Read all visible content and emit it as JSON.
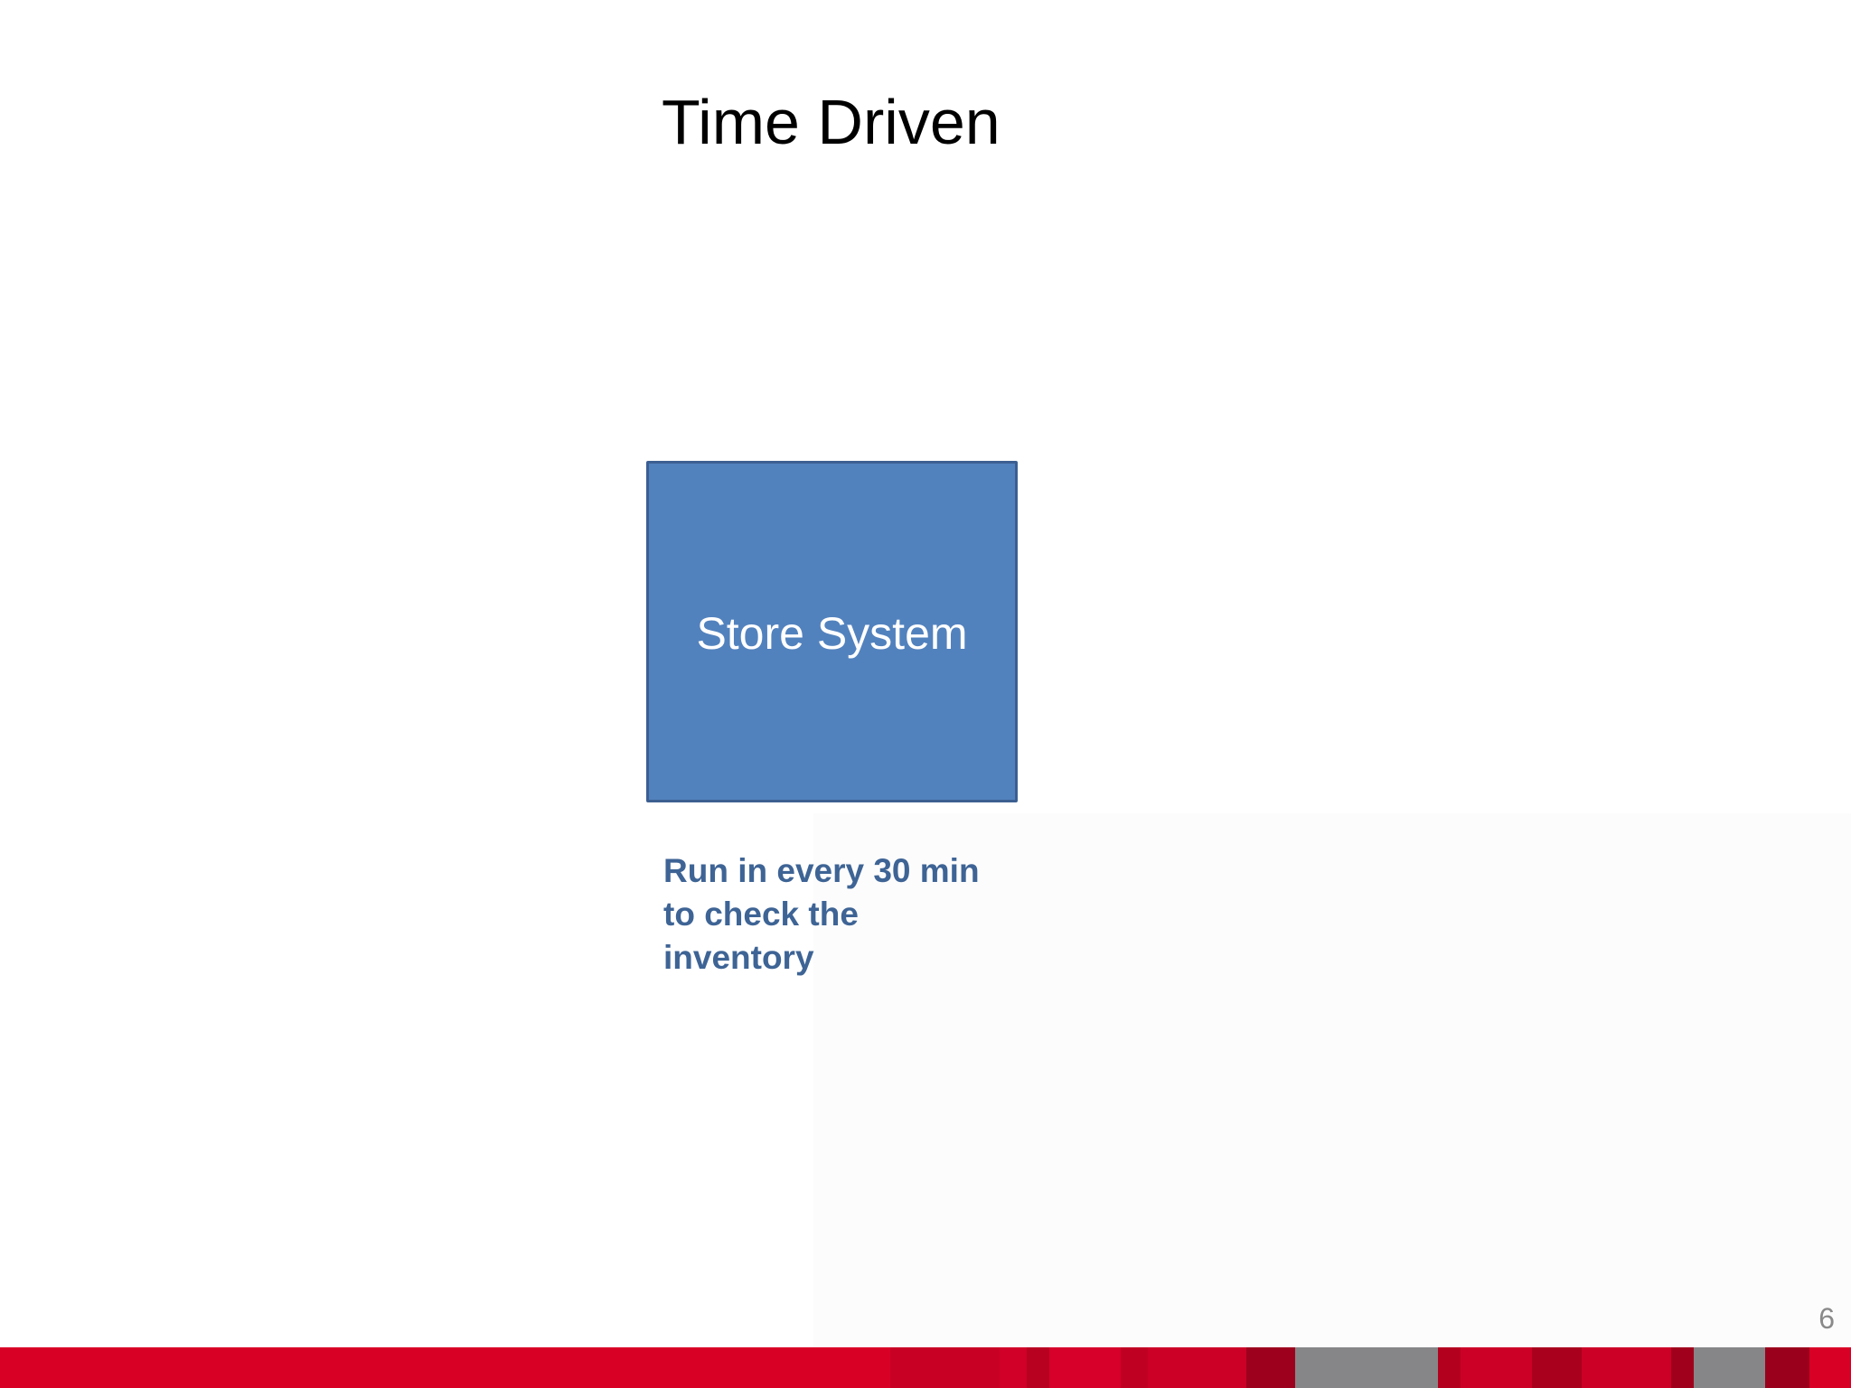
{
  "slide": {
    "title": "Time Driven",
    "page_number": "6"
  },
  "diagram": {
    "node": {
      "label": "Store System",
      "fill_color": "#5282be",
      "border_color": "#3c5f91"
    },
    "caption_lines": [
      "Run in every 30 min",
      "to check the",
      "inventory"
    ],
    "caption_color": "#3e6495"
  },
  "footer": {
    "colors": [
      "#d90026",
      "#c80024",
      "#d10028",
      "#b80020",
      "#d6002a",
      "#c00022",
      "#cc0027",
      "#9c001c",
      "#868688",
      "#b4001f",
      "#cc0027",
      "#a8001d",
      "#cc0027",
      "#a0001c",
      "#868688",
      "#9a001b",
      "#d90026"
    ]
  }
}
